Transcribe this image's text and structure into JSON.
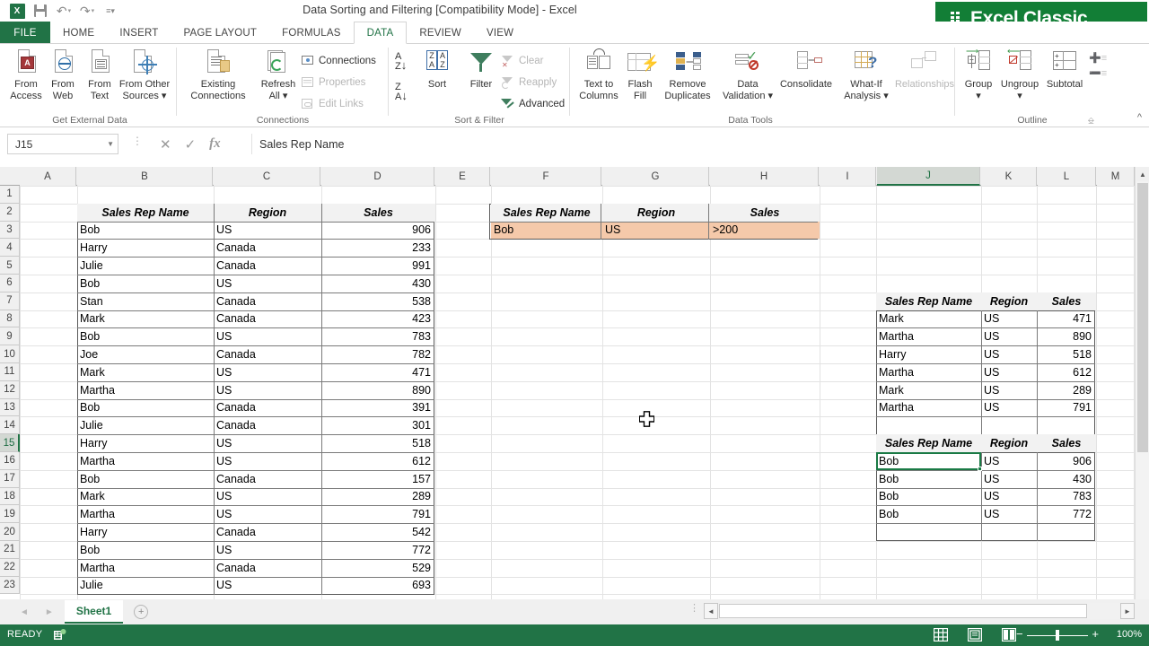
{
  "titlebar": {
    "document_title": "Data Sorting and Filtering  [Compatibility Mode] - Excel",
    "app_logo": "excel-logo",
    "qat": [
      {
        "name": "save-icon",
        "label": "Save"
      },
      {
        "name": "undo-icon",
        "label": "↶"
      },
      {
        "name": "redo-icon",
        "label": "↷"
      },
      {
        "name": "customize-qat-icon",
        "label": "≡"
      }
    ],
    "badge": "Excel Classic"
  },
  "ribbon": {
    "file_tab": "FILE",
    "tabs": [
      "HOME",
      "INSERT",
      "PAGE LAYOUT",
      "FORMULAS",
      "DATA",
      "REVIEW",
      "VIEW"
    ],
    "active_tab": "DATA",
    "collapse_icon": "chevron-up-icon",
    "groups": [
      {
        "name": "Get External Data",
        "buttons": [
          {
            "label_line1": "From",
            "label_line2": "Access",
            "icon": "from-access-icon"
          },
          {
            "label_line1": "From",
            "label_line2": "Web",
            "icon": "from-web-icon"
          },
          {
            "label_line1": "From",
            "label_line2": "Text",
            "icon": "from-text-icon"
          },
          {
            "label_line1": "From Other",
            "label_line2": "Sources ▾",
            "icon": "from-other-sources-icon"
          }
        ]
      },
      {
        "name": "Connections",
        "buttons": [
          {
            "label_line1": "Existing",
            "label_line2": "Connections",
            "icon": "existing-connections-icon"
          },
          {
            "label_line1": "Refresh",
            "label_line2": "All ▾",
            "icon": "refresh-all-icon"
          }
        ],
        "small_buttons": [
          {
            "label": "Connections",
            "icon": "connections-icon",
            "disabled": false
          },
          {
            "label": "Properties",
            "icon": "properties-icon",
            "disabled": true
          },
          {
            "label": "Edit Links",
            "icon": "edit-links-icon",
            "disabled": true
          }
        ]
      },
      {
        "name": "Sort & Filter",
        "buttons": [
          {
            "label_line1": "",
            "label_line2": "Sort",
            "icon": "sort-dialog-icon"
          },
          {
            "label_line1": "",
            "label_line2": "Filter",
            "icon": "filter-icon"
          }
        ],
        "sort_az": "sort-ascending-icon",
        "sort_za": "sort-descending-icon",
        "small_buttons": [
          {
            "label": "Clear",
            "icon": "clear-filter-icon",
            "disabled": true
          },
          {
            "label": "Reapply",
            "icon": "reapply-filter-icon",
            "disabled": true
          },
          {
            "label": "Advanced",
            "icon": "advanced-filter-icon",
            "disabled": false
          }
        ]
      },
      {
        "name": "Data Tools",
        "buttons": [
          {
            "label_line1": "Text to",
            "label_line2": "Columns",
            "icon": "text-to-columns-icon"
          },
          {
            "label_line1": "Flash",
            "label_line2": "Fill",
            "icon": "flash-fill-icon"
          },
          {
            "label_line1": "Remove",
            "label_line2": "Duplicates",
            "icon": "remove-duplicates-icon"
          },
          {
            "label_line1": "Data",
            "label_line2": "Validation ▾",
            "icon": "data-validation-icon"
          },
          {
            "label_line1": "",
            "label_line2": "Consolidate",
            "icon": "consolidate-icon"
          },
          {
            "label_line1": "What-If",
            "label_line2": "Analysis ▾",
            "icon": "what-if-analysis-icon"
          },
          {
            "label_line1": "",
            "label_line2": "Relationships",
            "icon": "relationships-icon"
          }
        ]
      },
      {
        "name": "Outline",
        "buttons": [
          {
            "label_line1": "Group",
            "label_line2": "▾",
            "icon": "group-icon"
          },
          {
            "label_line1": "Ungroup",
            "label_line2": "▾",
            "icon": "ungroup-icon"
          },
          {
            "label_line1": "",
            "label_line2": "Subtotal",
            "icon": "subtotal-icon"
          }
        ],
        "dialog_launcher": "dialog-launcher-icon"
      }
    ]
  },
  "formula_bar": {
    "name_box_value": "J15",
    "cancel_icon": "cancel-icon",
    "enter_icon": "enter-icon",
    "fx_icon": "insert-function-icon",
    "formula_value": "Sales Rep Name",
    "expand_icon": "chevron-down-icon"
  },
  "grid": {
    "columns": [
      "A",
      "B",
      "C",
      "D",
      "E",
      "F",
      "G",
      "H",
      "I",
      "J",
      "K",
      "L",
      "M"
    ],
    "selected_column": "J",
    "rows": [
      1,
      2,
      3,
      4,
      5,
      6,
      7,
      8,
      9,
      10,
      11,
      12,
      13,
      14,
      15,
      16,
      17,
      18,
      19,
      20,
      21,
      22,
      23
    ],
    "selected_row": 15,
    "selected_cell": "J15",
    "source_table": {
      "headers": [
        "Sales Rep Name",
        "Region",
        "Sales"
      ],
      "rows": [
        [
          "Bob",
          "US",
          "906"
        ],
        [
          "Harry",
          "Canada",
          "233"
        ],
        [
          "Julie",
          "Canada",
          "991"
        ],
        [
          "Bob",
          "US",
          "430"
        ],
        [
          "Stan",
          "Canada",
          "538"
        ],
        [
          "Mark",
          "Canada",
          "423"
        ],
        [
          "Bob",
          "US",
          "783"
        ],
        [
          "Joe",
          "Canada",
          "782"
        ],
        [
          "Mark",
          "US",
          "471"
        ],
        [
          "Martha",
          "US",
          "890"
        ],
        [
          "Bob",
          "Canada",
          "391"
        ],
        [
          "Julie",
          "Canada",
          "301"
        ],
        [
          "Harry",
          "US",
          "518"
        ],
        [
          "Martha",
          "US",
          "612"
        ],
        [
          "Bob",
          "Canada",
          "157"
        ],
        [
          "Mark",
          "US",
          "289"
        ],
        [
          "Martha",
          "US",
          "791"
        ],
        [
          "Harry",
          "Canada",
          "542"
        ],
        [
          "Bob",
          "US",
          "772"
        ],
        [
          "Martha",
          "Canada",
          "529"
        ],
        [
          "Julie",
          "US",
          "693"
        ]
      ]
    },
    "criteria_table": {
      "headers": [
        "Sales Rep Name",
        "Region",
        "Sales"
      ],
      "rows": [
        [
          "Bob",
          "US",
          ">200"
        ]
      ],
      "highlight_color": "#f5c9aa"
    },
    "result_table_top": {
      "headers": [
        "Sales Rep Name",
        "Region",
        "Sales"
      ],
      "rows": [
        [
          "Mark",
          "US",
          "471"
        ],
        [
          "Martha",
          "US",
          "890"
        ],
        [
          "Harry",
          "US",
          "518"
        ],
        [
          "Martha",
          "US",
          "612"
        ],
        [
          "Mark",
          "US",
          "289"
        ],
        [
          "Martha",
          "US",
          "791"
        ]
      ]
    },
    "result_table_bottom": {
      "headers": [
        "Sales Rep Name",
        "Region",
        "Sales"
      ],
      "rows": [
        [
          "Bob",
          "US",
          "906"
        ],
        [
          "Bob",
          "US",
          "430"
        ],
        [
          "Bob",
          "US",
          "783"
        ],
        [
          "Bob",
          "US",
          "772"
        ]
      ]
    }
  },
  "sheet_tabs": {
    "prev_icon": "nav-prev-icon",
    "next_icon": "nav-next-icon",
    "tabs": [
      "Sheet1"
    ],
    "active": "Sheet1",
    "add_sheet_icon": "add-sheet-icon"
  },
  "status_bar": {
    "state": "READY",
    "macro_icon": "record-macro-icon",
    "views": [
      {
        "name": "normal-view-icon",
        "label": "Normal"
      },
      {
        "name": "page-layout-view-icon",
        "label": "Page Layout"
      },
      {
        "name": "page-break-view-icon",
        "label": "Page Break Preview"
      }
    ],
    "zoom_out_icon": "zoom-out-icon",
    "zoom_in_icon": "zoom-in-icon",
    "zoom_level": "100%"
  },
  "colors": {
    "excel_green": "#217346",
    "badge_green": "#127e36",
    "criteria_highlight": "#f5c9aa",
    "selection_green": "#1a7a45"
  }
}
